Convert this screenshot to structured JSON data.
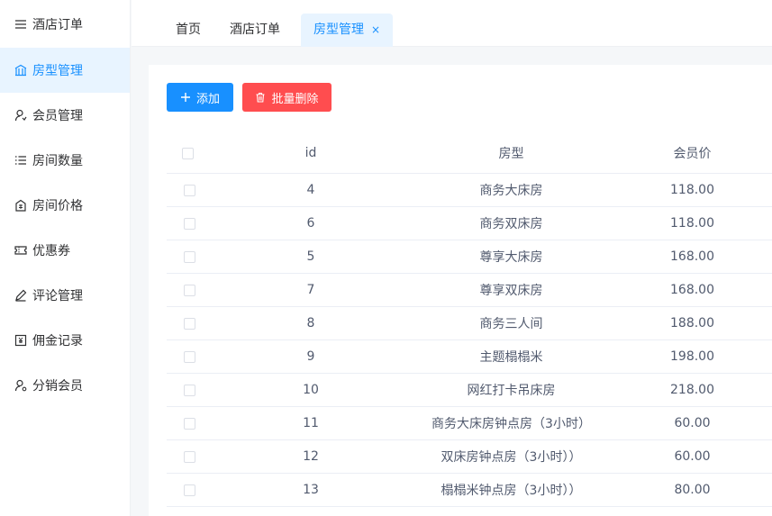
{
  "sidebar": {
    "items": [
      {
        "label": "酒店订单",
        "icon": "menu-lines-icon"
      },
      {
        "label": "房型管理",
        "icon": "building-icon"
      },
      {
        "label": "会员管理",
        "icon": "user-icon"
      },
      {
        "label": "房间数量",
        "icon": "list-icon"
      },
      {
        "label": "房间价格",
        "icon": "price-tag-icon"
      },
      {
        "label": "优惠券",
        "icon": "ticket-icon"
      },
      {
        "label": "评论管理",
        "icon": "pencil-icon"
      },
      {
        "label": "佣金记录",
        "icon": "yen-box-icon"
      },
      {
        "label": "分销会员",
        "icon": "user-share-icon"
      }
    ]
  },
  "tabs": [
    {
      "label": "首页"
    },
    {
      "label": "酒店订单"
    },
    {
      "label": "房型管理",
      "close": "×"
    }
  ],
  "toolbar": {
    "add_label": "添加",
    "batch_delete_label": "批量删除"
  },
  "table": {
    "columns": [
      "id",
      "房型",
      "会员价"
    ],
    "rows": [
      {
        "id": "4",
        "type": "商务大床房",
        "price": "118.00"
      },
      {
        "id": "6",
        "type": "商务双床房",
        "price": "118.00"
      },
      {
        "id": "5",
        "type": "尊享大床房",
        "price": "168.00"
      },
      {
        "id": "7",
        "type": "尊享双床房",
        "price": "168.00"
      },
      {
        "id": "8",
        "type": "商务三人间",
        "price": "188.00"
      },
      {
        "id": "9",
        "type": "主题榻榻米",
        "price": "198.00"
      },
      {
        "id": "10",
        "type": "网红打卡吊床房",
        "price": "218.00"
      },
      {
        "id": "11",
        "type": "商务大床房钟点房（3小时）",
        "price": "60.00"
      },
      {
        "id": "12",
        "type": "双床房钟点房（3小时））",
        "price": "60.00"
      },
      {
        "id": "13",
        "type": "榻榻米钟点房（3小时））",
        "price": "80.00"
      }
    ]
  },
  "colors": {
    "primary": "#1890ff",
    "danger": "#ff4d4f",
    "active_bg": "#e8f4ff"
  }
}
